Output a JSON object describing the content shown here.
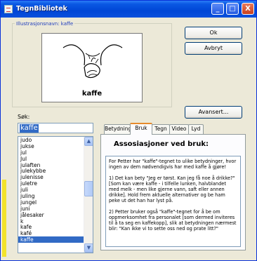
{
  "window": {
    "title": "TegnBibliotek",
    "min_label": "_",
    "max_label": "□",
    "close_label": "X"
  },
  "illustration": {
    "legend": "Illustrasjonsnavn: kaffe",
    "picture_label": "kaffe"
  },
  "buttons": {
    "ok": "Ok",
    "avbryt": "Avbryt",
    "avansert": "Avansert..."
  },
  "search": {
    "label": "Søk:",
    "value": "kaffe"
  },
  "word_list": {
    "items": [
      "judo",
      "jukse",
      "jul",
      "Jul",
      "julaften",
      "julekybbe",
      "julenisse",
      "juletre",
      "juli",
      "juling",
      "jungel",
      "juni",
      "jålesaker",
      "k",
      "kafe",
      "kafé",
      "kaffe"
    ],
    "selected": "kaffe"
  },
  "tabs": [
    "Betydning",
    "Bruk",
    "Tegn",
    "Video",
    "Lyd"
  ],
  "active_tab": "Bruk",
  "panel": {
    "heading": "Assosiasjoner ved bruk:",
    "paragraphs": [
      "For Petter har \"kaffe\"-tegnet to ulike betydninger, hvor ingen av dem nødvendigvis har med kaffe å gjøre!",
      "1) Det kan bety \"Jeg er tørst. Kan jeg få noe å drikke?\" [Som kan være kaffe - i tilfelle lunken, halvblandet med melk - men like gjerne vann, saft eller annen drikke]. Hold frem aktuelle alternativer og be ham peke ut det han har lyst på.",
      "2) Petter bruker også \"kaffe\"-tegnet for å be om oppmerksomhet fra personalet [som dermed inviteres til å ta seg en kaffekopp], slik at betydningen nærmest blir: \"Kan ikke vi to sette oss ned og prate litt?\""
    ]
  }
}
